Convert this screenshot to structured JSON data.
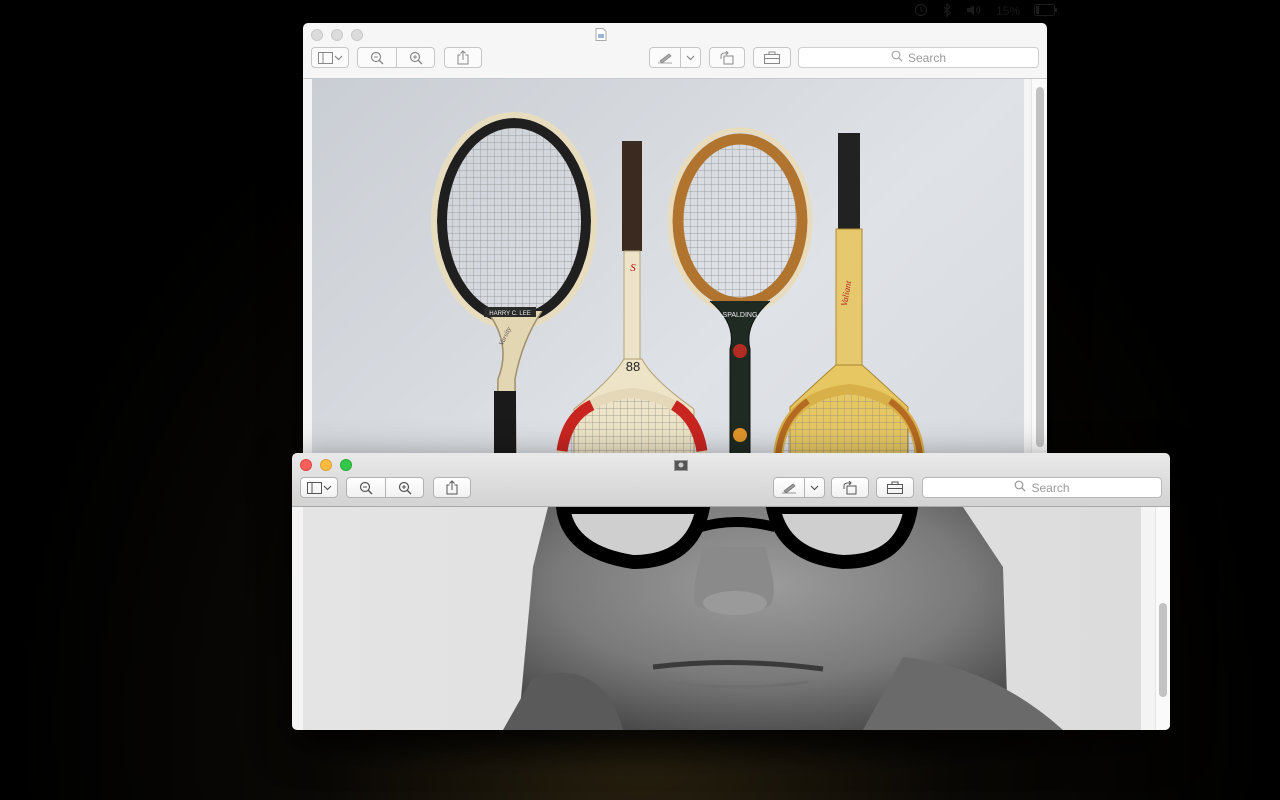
{
  "menubar": {
    "battery": "15%",
    "icons": [
      "time-machine-icon",
      "bluetooth-icon",
      "volume-icon",
      "battery-icon"
    ]
  },
  "back_window": {
    "search_placeholder": "Search",
    "icons": [
      "sidebar-icon",
      "chevron-down-icon",
      "zoom-out-icon",
      "zoom-in-icon",
      "share-icon",
      "markup-pen-icon",
      "chevron-down-icon",
      "rotate-icon",
      "toolbox-icon",
      "search-icon"
    ],
    "image_subject": "four vintage wooden tennis rackets leaning against a white wall",
    "racket_labels": [
      "HARRY C. LEE",
      "Varsity",
      "88",
      "SPALDING",
      "Valiant"
    ]
  },
  "front_window": {
    "search_placeholder": "Search",
    "icons": [
      "sidebar-icon",
      "chevron-down-icon",
      "zoom-out-icon",
      "zoom-in-icon",
      "share-icon",
      "markup-pen-icon",
      "chevron-down-icon",
      "rotate-icon",
      "toolbox-icon",
      "search-icon"
    ],
    "image_subject": "black and white close-up portrait of a man wearing round black glasses"
  },
  "colors": {
    "close": "#fc605b",
    "minimize": "#fdbc40",
    "zoom": "#34c84a",
    "desktop": "#000000"
  }
}
